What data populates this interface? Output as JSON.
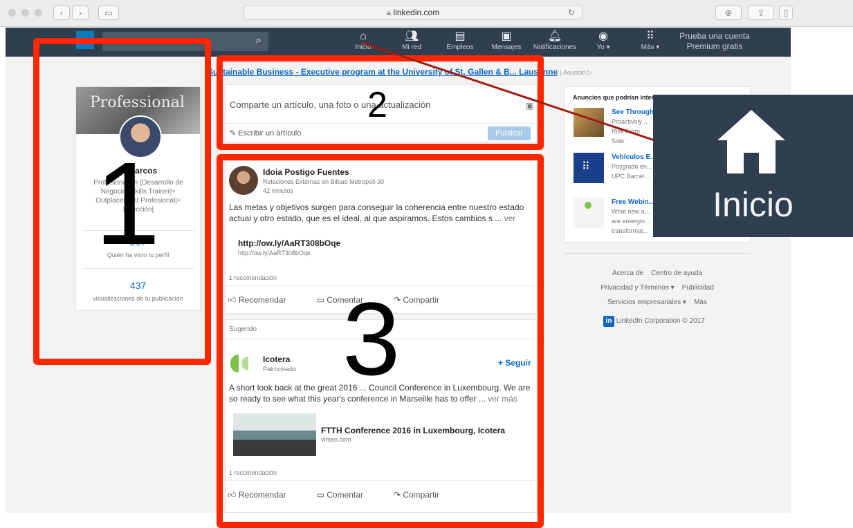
{
  "browser": {
    "url": "linkedin.com"
  },
  "nav": {
    "search_icon": "search-icon",
    "items": [
      {
        "icon": "home-icon",
        "label": "Inicio"
      },
      {
        "icon": "network-icon",
        "label": "Mi red"
      },
      {
        "icon": "briefcase-icon",
        "label": "Empleos"
      },
      {
        "icon": "messages-icon",
        "label": "Mensajes"
      },
      {
        "icon": "bell-icon",
        "label": "Notificaciones"
      },
      {
        "icon": "avatar",
        "label": "Yo ▾"
      },
      {
        "icon": "grid-icon",
        "label": "Más ▾"
      }
    ],
    "premium": [
      "Prueba una cuenta",
      "Premium gratis"
    ]
  },
  "ad_banner": {
    "text": "Sustainable Business - Executive program at the University of St. Gallen & B... Lausanne",
    "tag": "Anuncio"
  },
  "profile": {
    "banner_text": "Professional",
    "name": "... Marcos",
    "headline": "Profesional en (Desarrollo de Negocio) Skills Trainer|+ Outplacement Profesional|+ Dirección|",
    "views_count": "217",
    "views_label": "Quién ha visto tu perfil",
    "post_views_count": "437",
    "post_views_label": "visualizaciones de tu publicación"
  },
  "share": {
    "prompt": "Comparte un artículo, una foto o una actualización",
    "write_article": "Escribir un artículo",
    "publish": "Publicar"
  },
  "posts": [
    {
      "author": "Idoia Postigo Fuentes",
      "role": "Relaciones Externas en Bilbao Metropoli-30",
      "time": "42 minutos",
      "text": "Las metas y objetivos surgen para conseguir la coherencia entre nuestro estado actual y otro estado, que es el ideal, al que aspiramos. Estos cambios s ...",
      "more": "ver más",
      "link_title": "http://ow.ly/AaRT308bOqe",
      "link_sub": "http://ow.ly/AaRT308bOqe",
      "recs": "1 recomendación"
    },
    {
      "section": "Sugerido",
      "author": "Icotera",
      "role": "Patrocinado",
      "follow": "+ Seguir",
      "text": "A short look back at the great 2016 ... Council Conference in Luxembourg. We are so ready to see what this year's conference in Marseille has to offer ...",
      "more": "ver más",
      "link_title": "FTTH Conference 2016 in Luxembourg, Icotera",
      "link_sub": "vimeo.com",
      "recs": "1 recomendación"
    }
  ],
  "actions": [
    "Recomendar",
    "Comentar",
    "Compartir"
  ],
  "right_ads": {
    "title": "Anuncios que podrían interesarte",
    "items": [
      {
        "title": "See Through...",
        "lines": [
          "Proactively ...",
          "Risk From ...",
          "Side"
        ]
      },
      {
        "title": "Vehículos E...",
        "lines": [
          "Posgrado en...",
          "UPC Barcel..."
        ]
      },
      {
        "title": "Free Webin...",
        "lines": [
          "What new a...",
          "are emergin...",
          "transformat..."
        ]
      }
    ]
  },
  "footer": {
    "links": [
      "Acerca de",
      "Centro de ayuda",
      "Privacidad y Términos",
      "Publicidad",
      "Servicios empresariales",
      "Más"
    ],
    "copyright": "LinkedIn Corporation © 2017"
  },
  "callout": {
    "label": "Inicio",
    "icon": "home-icon"
  },
  "annotations": [
    "1",
    "2",
    "3"
  ],
  "colors": {
    "nav_bg": "#2f3f4f",
    "callout_bg": "#2f3f4f",
    "highlight": "#ff2600",
    "arrow": "#a11b10",
    "link": "#0a66c2"
  }
}
